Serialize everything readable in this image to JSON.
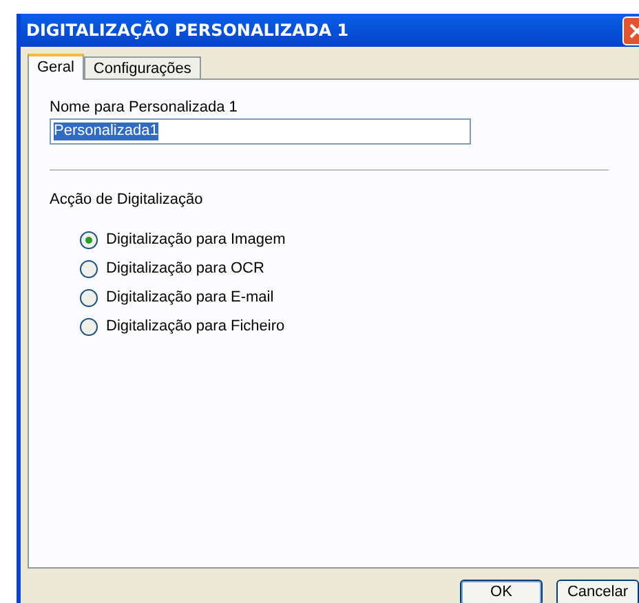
{
  "window": {
    "title": "DIGITALIZAÇÃO PERSONALIZADA 1"
  },
  "tabs": [
    {
      "label": "Geral",
      "selected": true
    },
    {
      "label": "Configurações",
      "selected": false
    }
  ],
  "name_field": {
    "label": "Nome para Personalizada 1",
    "value": "Personalizada1"
  },
  "scan_action": {
    "label": "Acção de Digitalização",
    "options": [
      {
        "label": "Digitalização para Imagem",
        "selected": true
      },
      {
        "label": "Digitalização para OCR",
        "selected": false
      },
      {
        "label": "Digitalização para E-mail",
        "selected": false
      },
      {
        "label": "Digitalização para Ficheiro",
        "selected": false
      }
    ]
  },
  "buttons": [
    "OK",
    "Cancelar"
  ]
}
